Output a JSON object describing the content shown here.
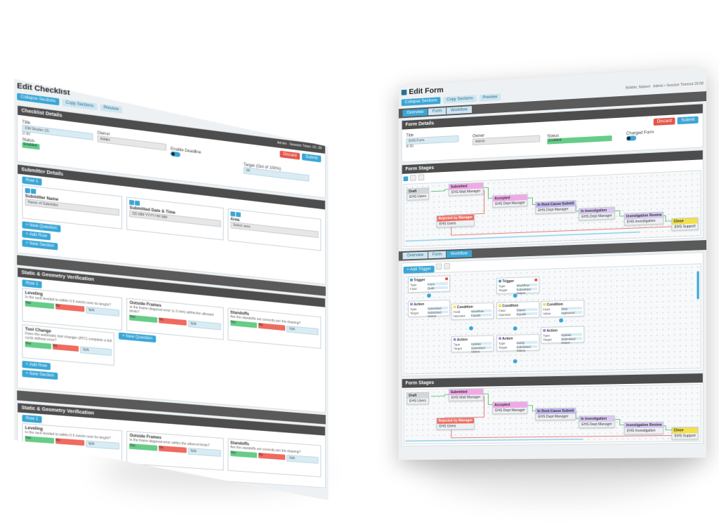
{
  "left": {
    "title": "Edit Checklist",
    "toolbar": [
      "Collapse Sections",
      "Copy Sections",
      "Preview"
    ],
    "details": {
      "header": "Checklist Details",
      "admin": "Admin",
      "session": "Session Timer: 01: 28",
      "discard": "Discard",
      "submit": "Submit",
      "title_label": "Title",
      "title_value": "DM Shutter (3)",
      "title_hint": "2/ 80",
      "owner_label": "Owner",
      "owner_value": "Admin",
      "status_label": "Status",
      "status_value": "Enabled",
      "enable_label": "Enable Deadline",
      "target_label": "Target (Out of 100%)",
      "target_value": "90"
    },
    "submitter": {
      "header": "Submitter Details",
      "button": "Row 1",
      "col1_label": "Submitter Name",
      "col1_value": "Name of Submitter",
      "col2_label": "Submitted Date & Time",
      "col2_value": "DD MM YYYY HH MM",
      "col3_label": "Area",
      "col3_value": "Select area",
      "new_question": "+ New Question",
      "add_row": "+ Add Row",
      "new_section": "+ New Section"
    },
    "section1": {
      "header": "Static & Geometry Verification",
      "button": "Row 1",
      "cards": [
        {
          "title": "Leveling",
          "text": "Is the rack leveled to within 0.5 mm/m over its length?",
          "yes": "Yes",
          "no": "No",
          "na": "N/A"
        },
        {
          "title": "Outside Frames",
          "text": "Is the frame diagonal error (≤ 3 mm) within the allowed limits?",
          "yes": "Yes",
          "no": "No",
          "na": "N/A"
        },
        {
          "title": "Standoffs",
          "text": "Are the standoffs set correctly per the drawing?",
          "yes": "Yes",
          "no": "No",
          "na": "N/A"
        },
        {
          "title": "Tool Change",
          "text": "Does the automatic tool changer (ATC) complete a full cycle without error?",
          "yes": "Yes",
          "no": "No",
          "na": "N/A"
        }
      ],
      "new_question": "+ New Question",
      "add_row": "+ Add Row",
      "new_section": "+ New Section"
    },
    "section2": {
      "header": "Static & Geometry Verification",
      "button": "Row 1",
      "cards": [
        {
          "title": "Leveling",
          "text": "Is the rack leveled to within 0.5 mm/m over its length?",
          "yes": "Yes",
          "no": "No",
          "na": "N/A"
        },
        {
          "title": "Outside Frames",
          "text": "Is the frame diagonal error within the allowed limits?",
          "yes": "Yes",
          "no": "No",
          "na": "N/A"
        },
        {
          "title": "Standoffs",
          "text": "Are the standoffs set correctly per the drawing?",
          "yes": "Yes",
          "no": "No",
          "na": "N/A"
        }
      ]
    }
  },
  "right": {
    "title": "Edit Form",
    "toolbar": [
      "Collapse Sections",
      "Copy Sections",
      "Preview"
    ],
    "user": "Bobbin, Nabeel",
    "session": "Admin • Session Timeout 29:08",
    "tabs": [
      "Overview",
      "Form",
      "Workflow"
    ],
    "details": {
      "header": "Form Details",
      "discard": "Discard",
      "submit": "Submit",
      "title_label": "Title",
      "title_value": "EHS Form",
      "title_hint": "8/ 80",
      "owner_label": "Owner",
      "owner_value": "Admin",
      "status_label": "Status",
      "status_value": "Enabled",
      "charged_label": "Charged Form"
    },
    "stages": {
      "header": "Form Stages",
      "nodes": [
        {
          "title": "Draft",
          "sub": "EHS Users",
          "color": "gray"
        },
        {
          "title": "Submitted",
          "sub": "EHS Wait Manager",
          "color": "pink"
        },
        {
          "title": "Rejected by Manager",
          "sub": "EHS Users",
          "color": "red"
        },
        {
          "title": "Accepted",
          "sub": "EHS Dept Manager",
          "color": "pink"
        },
        {
          "title": "In Root-Cause Submit",
          "sub": "EHS Dept Manager",
          "color": "purple"
        },
        {
          "title": "In Investigation",
          "sub": "EHS Dept Manager",
          "color": "lilac"
        },
        {
          "title": "Investigation Review",
          "sub": "EHS Investigation",
          "color": "lilac"
        },
        {
          "title": "Close",
          "sub": "EHS Support",
          "color": "yellow"
        }
      ]
    },
    "workflow_tabs": [
      "Overview",
      "Form",
      "Workflow"
    ],
    "workflow_button": "+ Add Trigger",
    "workflow_nodes": [
      {
        "title": "Trigger",
        "l1": "Type",
        "v1": "Form Submission",
        "l2": "Field",
        "v2": "Draft"
      },
      {
        "title": "Trigger",
        "l1": "Type",
        "v1": "Workflow Event",
        "l2": "Target",
        "v2": "Submitted Status"
      },
      {
        "title": "Action",
        "l1": "Type",
        "v1": "Submitted",
        "l2": "Target",
        "v2": "Submitted Status"
      },
      {
        "title": "Condition",
        "l1": "Field",
        "v1": "Workflow Event",
        "l2": "Operator",
        "v2": "Equals"
      },
      {
        "title": "Condition",
        "l1": "Field",
        "v1": "Status",
        "l2": "Operator",
        "v2": "Equals"
      },
      {
        "title": "Condition",
        "l1": "Field",
        "v1": "Step",
        "l2": "Value",
        "v2": "Approved"
      },
      {
        "title": "Action",
        "l1": "Type",
        "v1": "Update",
        "l2": "Target",
        "v2": "Submitted Status"
      },
      {
        "title": "Action",
        "l1": "Type",
        "v1": "Notify",
        "l2": "Target",
        "v2": "Submitted Status"
      },
      {
        "title": "Action",
        "l1": "Type",
        "v1": "Update",
        "l2": "Target",
        "v2": "Submitted Status"
      }
    ],
    "stages2_header": "Form Stages"
  }
}
